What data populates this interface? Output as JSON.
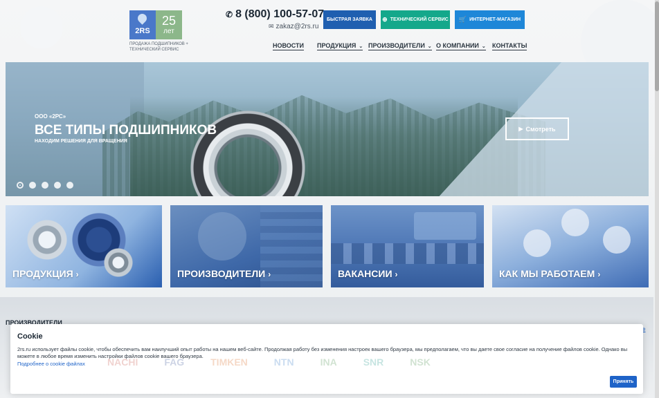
{
  "header": {
    "logo": {
      "brand": "2RS",
      "years_num": "25",
      "years_word": "лет"
    },
    "tagline": "ПРОДАЖА ПОДШИПНИКОВ + ТЕХНИЧЕСКИЙ СЕРВИС",
    "phone": "8 (800) 100-57-07",
    "email": "zakaz@2rs.ru",
    "buttons": {
      "quick": "БЫСТРАЯ ЗАЯВКА",
      "tech": "ТЕХНИЧЕСКИЙ СЕРВИС",
      "shop": "ИНТЕРНЕТ-МАГАЗИН"
    },
    "nav": {
      "news": "НОВОСТИ",
      "products": "ПРОДУКЦИЯ",
      "makers": "ПРОИЗВОДИТЕЛИ",
      "about": "О КОМПАНИИ",
      "contacts": "КОНТАКТЫ"
    }
  },
  "hero": {
    "subtitle": "ООО «2РС»",
    "title": "ВСЕ ТИПЫ ПОДШИПНИКОВ",
    "caption": "НАХОДИМ РЕШЕНИЯ ДЛЯ ВРАЩЕНИЯ",
    "watch_label": "Смотреть",
    "slides_count": 5,
    "active_slide": 1
  },
  "tiles": {
    "products": "ПРОДУКЦИЯ",
    "makers": "ПРОИЗВОДИТЕЛИ",
    "vacancies": "ВАКАНСИИ",
    "how": "КАК МЫ РАБОТАЕМ"
  },
  "makers_section": {
    "heading": "ПРОИЗВОДИТЕЛИ",
    "all_link": "е"
  },
  "cookie": {
    "title": "Cookie",
    "text": "2rs.ru использует файлы cookie, чтобы обеспечить вам наилучший опыт работы на нашем веб-сайте. Продолжая работу без изменения настроек вашего браузера, мы предполагаем, что вы даете свое согласие на получение файлов cookie. Однако вы можете в любое время изменить настройки файлов cookie вашего браузера.",
    "link": "Подробнее о cookie файлах",
    "accept": "Принять",
    "faded_brands": [
      "NACHI",
      "FAG",
      "TIMKEN",
      "NTN",
      "INA",
      "SNR",
      "NSK"
    ]
  },
  "colors": {
    "quick_btn": "#1f5fb0",
    "tech_btn": "#14a88b",
    "shop_btn": "#1e87d8",
    "link": "#1e63c8"
  }
}
